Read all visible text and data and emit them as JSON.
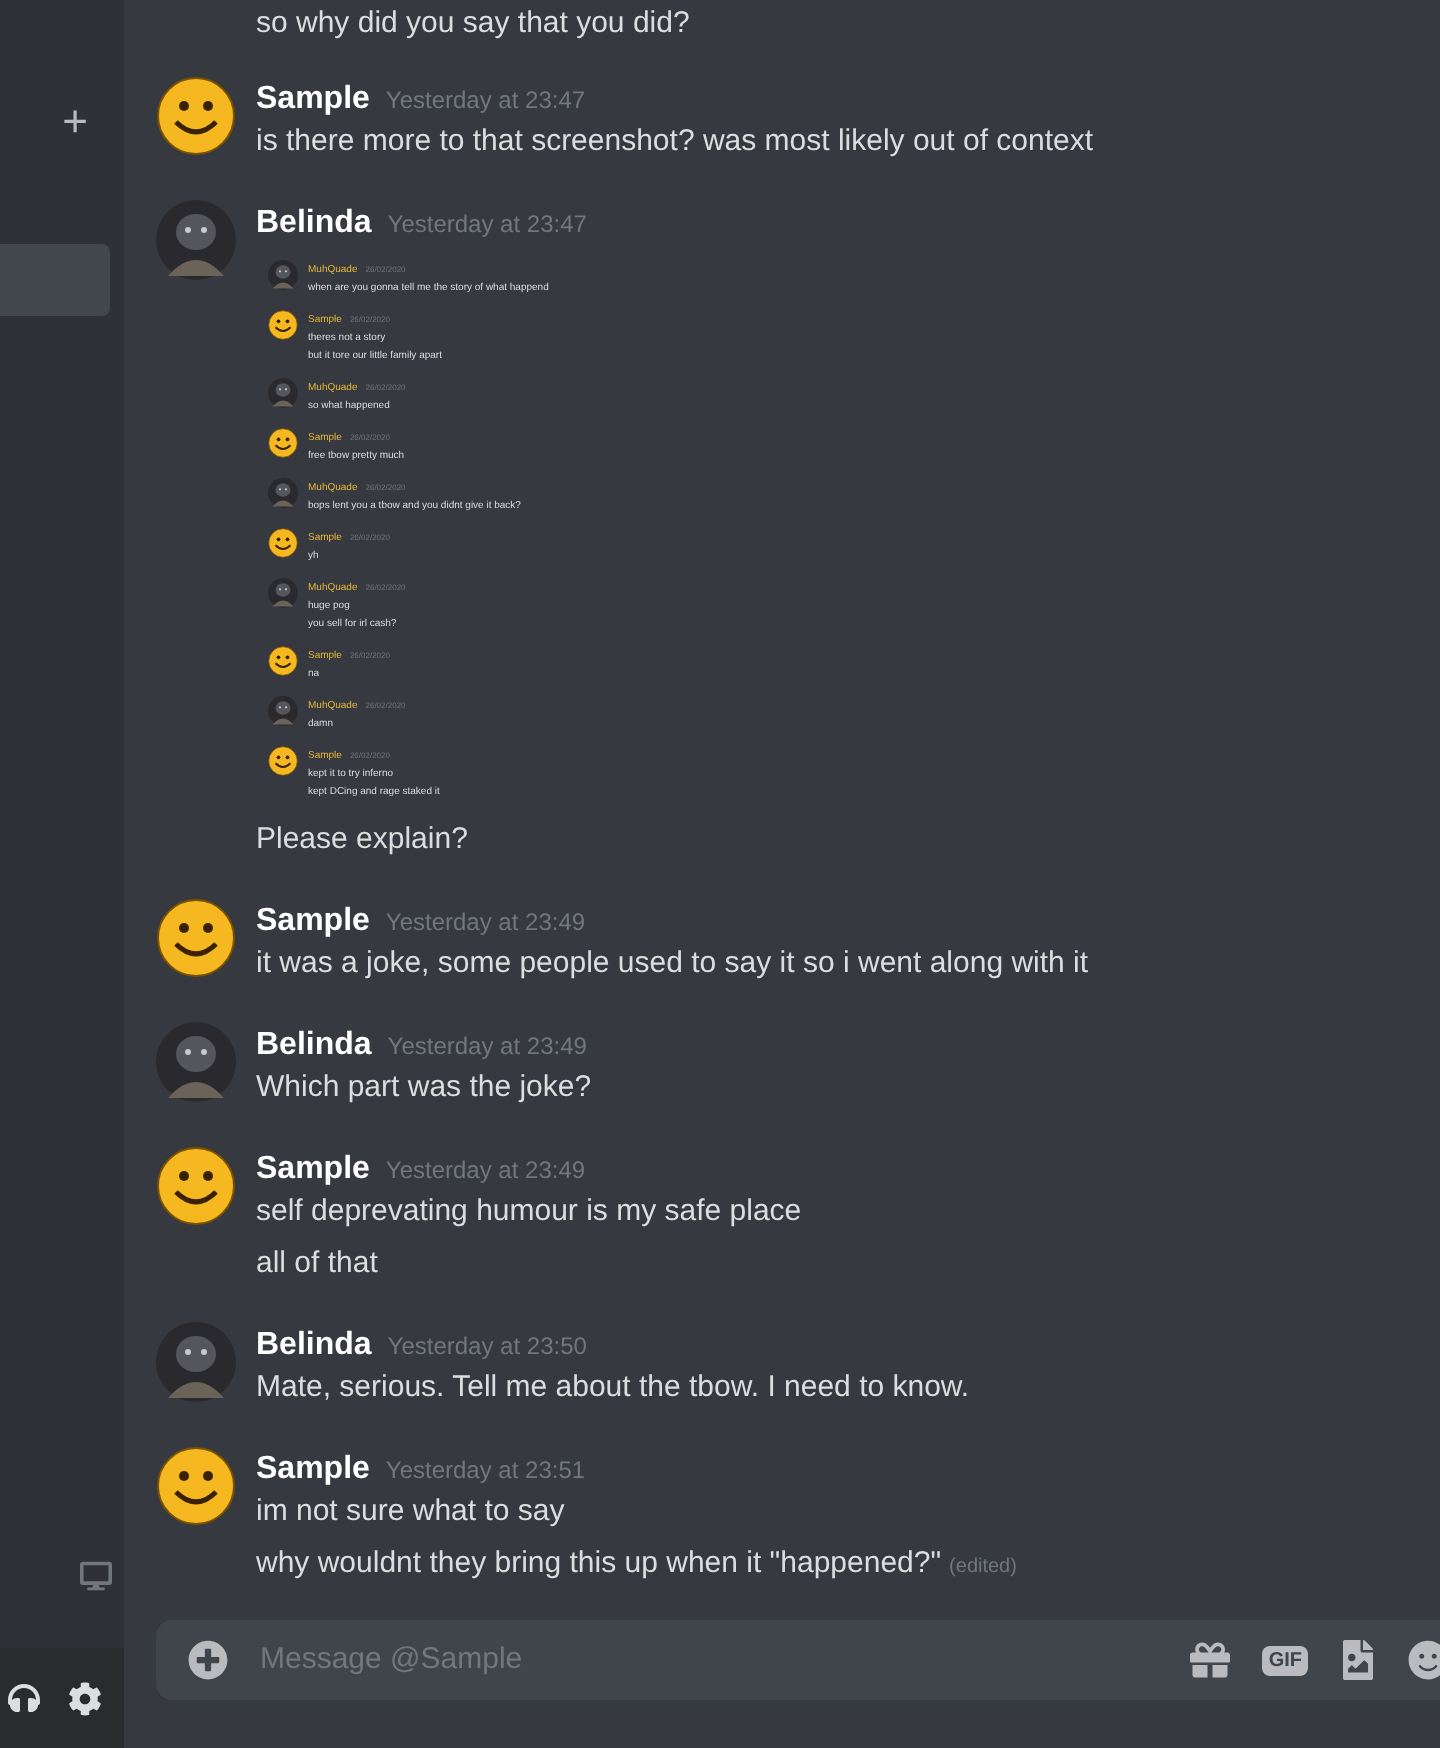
{
  "previous_line": "so why did you say that you did?",
  "messages": [
    {
      "author": "Sample",
      "kind": "smiley",
      "timestamp": "Yesterday at 23:47",
      "lines": [
        {
          "text": "is there more to that screenshot? was most likely out of context"
        }
      ]
    },
    {
      "author": "Belinda",
      "kind": "dark",
      "timestamp": "Yesterday at 23:47",
      "attachment": {
        "kind": "screenshot",
        "messages": [
          {
            "author": "MuhQuade",
            "kind": "dark",
            "date": "26/02/2020",
            "lines": [
              "when are you gonna tell me the story of what happend"
            ]
          },
          {
            "author": "Sample",
            "kind": "smiley",
            "date": "26/02/2020",
            "lines": [
              "theres not a story",
              "but it tore our little family apart"
            ]
          },
          {
            "author": "MuhQuade",
            "kind": "dark",
            "date": "26/02/2020",
            "lines": [
              "so what happened"
            ]
          },
          {
            "author": "Sample",
            "kind": "smiley",
            "date": "26/02/2020",
            "lines": [
              "free tbow pretty much"
            ]
          },
          {
            "author": "MuhQuade",
            "kind": "dark",
            "date": "26/02/2020",
            "lines": [
              "bops lent you a tbow and you didnt give it back?"
            ]
          },
          {
            "author": "Sample",
            "kind": "smiley",
            "date": "26/02/2020",
            "lines": [
              "yh"
            ]
          },
          {
            "author": "MuhQuade",
            "kind": "dark",
            "date": "26/02/2020",
            "lines": [
              "huge pog",
              "you sell for irl cash?"
            ]
          },
          {
            "author": "Sample",
            "kind": "smiley",
            "date": "26/02/2020",
            "lines": [
              "na"
            ]
          },
          {
            "author": "MuhQuade",
            "kind": "dark",
            "date": "26/02/2020",
            "lines": [
              "damn"
            ]
          },
          {
            "author": "Sample",
            "kind": "smiley",
            "date": "26/02/2020",
            "lines": [
              "kept it to try inferno",
              "kept DCing and rage staked it"
            ]
          }
        ]
      },
      "lines": [
        {
          "text": "Please explain?"
        }
      ]
    },
    {
      "author": "Sample",
      "kind": "smiley",
      "timestamp": "Yesterday at 23:49",
      "lines": [
        {
          "text": "it was a joke, some people used to say it so i went along with it"
        }
      ]
    },
    {
      "author": "Belinda",
      "kind": "dark",
      "timestamp": "Yesterday at 23:49",
      "lines": [
        {
          "text": "Which part was the joke?"
        }
      ]
    },
    {
      "author": "Sample",
      "kind": "smiley",
      "timestamp": "Yesterday at 23:49",
      "lines": [
        {
          "text": "self deprevating humour is my safe place"
        },
        {
          "text": "all of that"
        }
      ]
    },
    {
      "author": "Belinda",
      "kind": "dark",
      "timestamp": "Yesterday at 23:50",
      "lines": [
        {
          "text": "Mate, serious. Tell me about the tbow. I need to know."
        }
      ]
    },
    {
      "author": "Sample",
      "kind": "smiley",
      "timestamp": "Yesterday at 23:51",
      "lines": [
        {
          "text": "im not sure what to say"
        },
        {
          "text": "why wouldnt they bring this up when it \"happened?\"",
          "edited": "(edited)"
        }
      ]
    }
  ],
  "sidebar": {
    "add": "+"
  },
  "composer": {
    "placeholder": "Message @Sample",
    "gif": "GIF"
  }
}
